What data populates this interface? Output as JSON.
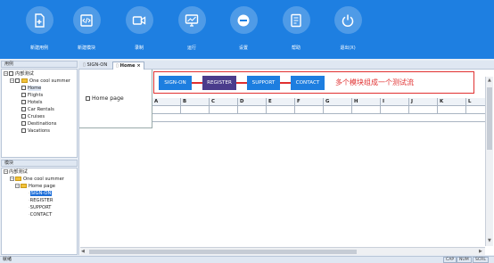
{
  "toolbar": {
    "items": [
      {
        "label": "新建用例",
        "icon": "new-file-icon"
      },
      {
        "label": "新建模块",
        "icon": "new-module-icon"
      },
      {
        "label": "录制",
        "icon": "record-camera-icon"
      },
      {
        "label": "运行",
        "icon": "run-monitor-icon"
      },
      {
        "label": "设置",
        "icon": "settings-minus-icon"
      },
      {
        "label": "帮助",
        "icon": "help-book-icon"
      },
      {
        "label": "退出(X)",
        "icon": "power-icon"
      }
    ]
  },
  "cases_panel": {
    "title": "用例",
    "root": "内部测试",
    "project": "One cool summer",
    "items": [
      "Home",
      "Flights",
      "Hotels",
      "Car Rentals",
      "Cruises",
      "Destinations",
      "Vacations"
    ]
  },
  "modules_panel": {
    "title": "模块",
    "root": "内部测试",
    "project": "One cool summer",
    "page": "Home page",
    "items": [
      "SIGN-ON",
      "REGISTER",
      "SUPPORT",
      "CONTACT"
    ]
  },
  "tabs": [
    {
      "label": "SIGN-ON"
    },
    {
      "label": "Home",
      "close": "×"
    }
  ],
  "editor": {
    "page_label": "Home page",
    "flow_modules": [
      "SIGN-ON",
      "REGISTER",
      "SUPPORT",
      "CONTACT"
    ],
    "flow_colors": [
      "#1d7ee0",
      "#4a3c8c",
      "#1d7ee0",
      "#1d7ee0"
    ],
    "note": "多个模块组成一个测试流",
    "columns": [
      "A",
      "B",
      "C",
      "D",
      "E",
      "F",
      "G",
      "H",
      "I",
      "J",
      "K",
      "L"
    ]
  },
  "status": {
    "left": "就绪",
    "indicators": [
      "CAP",
      "NUM",
      "SCRL"
    ]
  }
}
